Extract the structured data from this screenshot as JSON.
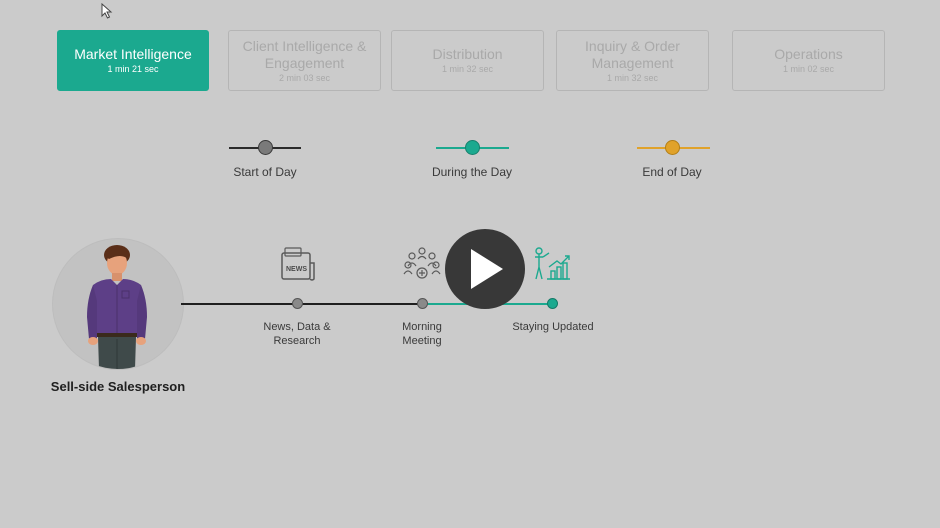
{
  "tabs": [
    {
      "title": "Market Intelligence",
      "duration": "1 min 21 sec"
    },
    {
      "title": "Client Intelligence & Engagement",
      "duration": "2 min 03 sec"
    },
    {
      "title": "Distribution",
      "duration": "1 min 32 sec"
    },
    {
      "title": "Inquiry & Order Management",
      "duration": "1 min 32 sec"
    },
    {
      "title": "Operations",
      "duration": "1 min 02 sec"
    }
  ],
  "legend": [
    {
      "label": "Start of Day",
      "color": "#2b2b2b",
      "dot": "#7a7a7a"
    },
    {
      "label": "During the Day",
      "color": "#1ba98f",
      "dot": "#1ba98f"
    },
    {
      "label": "End of Day",
      "color": "#e0a22a",
      "dot": "#e0a22a"
    }
  ],
  "person": {
    "name": "Sell-side Salesperson"
  },
  "timeline": [
    {
      "label": "News, Data & Research",
      "icon": "news-icon"
    },
    {
      "label": "Morning Meeting",
      "icon": "meeting-icon"
    },
    {
      "label": "Staying Updated",
      "icon": "growth-chart-icon"
    }
  ],
  "colors": {
    "accent": "#1ba98f",
    "background": "#cbcbcb",
    "play": "#383838"
  },
  "icons": {
    "cursor": "arrow-cursor-icon",
    "play": "play-icon"
  }
}
